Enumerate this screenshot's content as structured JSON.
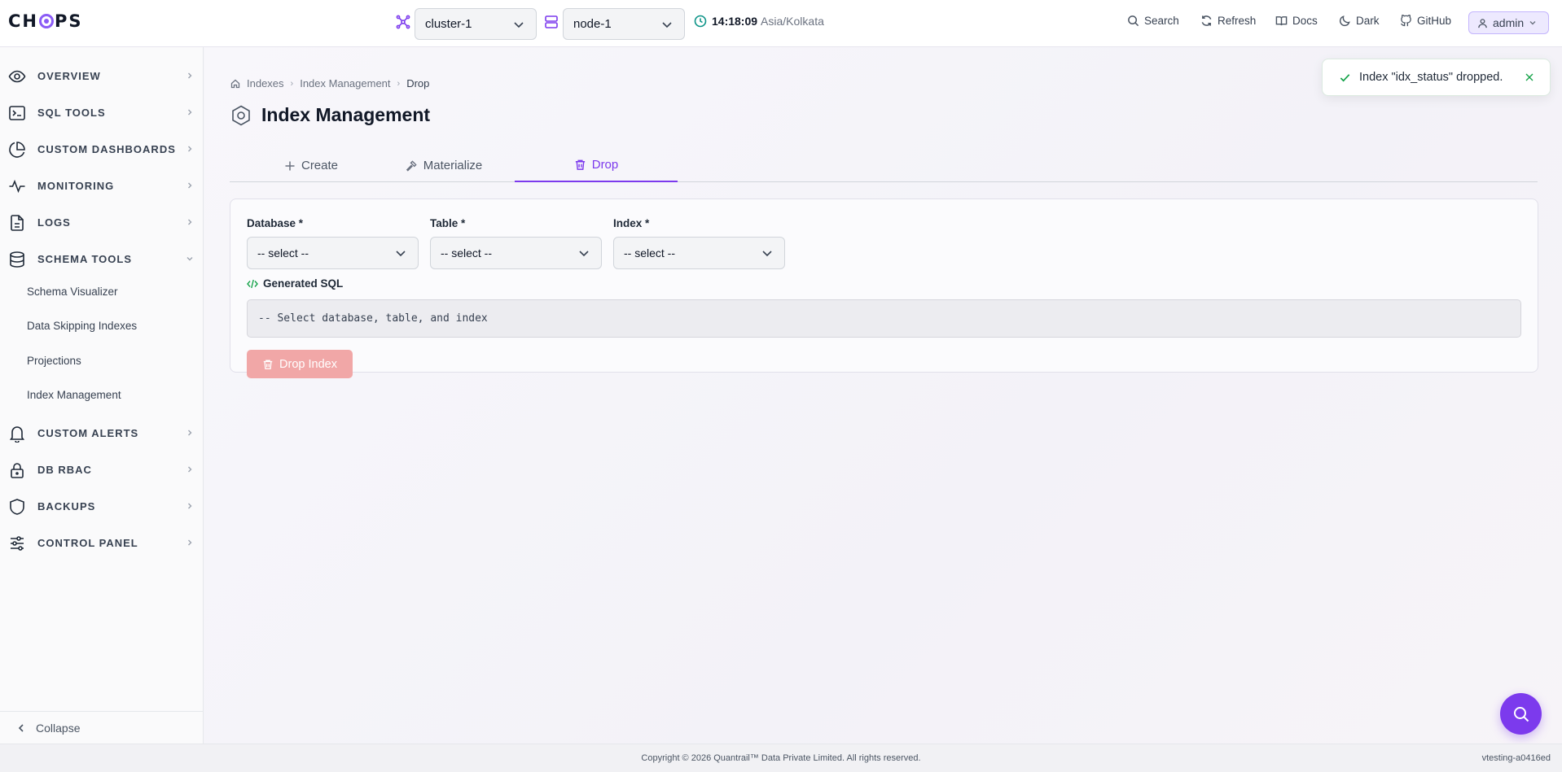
{
  "app": {
    "logo_text": "CHOPS",
    "accent_color": "#7c3aed"
  },
  "header": {
    "cluster_select": "cluster-1",
    "node_select": "node-1",
    "time": "14:18:09",
    "timezone": "Asia/Kolkata",
    "actions": [
      {
        "label": "Search",
        "icon": "search-icon"
      },
      {
        "label": "Refresh",
        "icon": "refresh-icon"
      },
      {
        "label": "Docs",
        "icon": "book-icon"
      },
      {
        "label": "Dark",
        "icon": "moon-icon"
      },
      {
        "label": "GitHub",
        "icon": "github-icon"
      }
    ],
    "user_label": "admin"
  },
  "sidebar": {
    "items": [
      {
        "label": "OVERVIEW",
        "icon": "eye-icon"
      },
      {
        "label": "SQL TOOLS",
        "icon": "terminal-icon"
      },
      {
        "label": "CUSTOM DASHBOARDS",
        "icon": "pie-chart-icon"
      },
      {
        "label": "MONITORING",
        "icon": "activity-icon"
      },
      {
        "label": "LOGS",
        "icon": "file-text-icon"
      },
      {
        "label": "SCHEMA TOOLS",
        "icon": "database-icon",
        "expanded": true
      },
      {
        "label": "CUSTOM ALERTS",
        "icon": "bell-icon"
      },
      {
        "label": "DB RBAC",
        "icon": "lock-icon"
      },
      {
        "label": "BACKUPS",
        "icon": "shield-icon"
      },
      {
        "label": "CONTROL PANEL",
        "icon": "sliders-icon"
      }
    ],
    "schema_subitems": [
      "Schema Visualizer",
      "Data Skipping Indexes",
      "Projections",
      "Index Management"
    ],
    "collapse_label": "Collapse"
  },
  "main": {
    "breadcrumb": [
      "Indexes",
      "Index Management",
      "Drop"
    ],
    "title": "Index Management",
    "tabs": [
      {
        "label": "Create",
        "icon": "plus-icon"
      },
      {
        "label": "Materialize",
        "icon": "hammer-icon"
      },
      {
        "label": "Drop",
        "icon": "trash-icon",
        "active": true
      }
    ],
    "form": {
      "database_label": "Database *",
      "database_value": "-- select --",
      "table_label": "Table *",
      "table_value": "-- select --",
      "index_label": "Index *",
      "index_value": "-- select --",
      "sql_label": "Generated SQL",
      "sql_value": "-- Select database, table, and index",
      "drop_button": "Drop Index"
    }
  },
  "toast": {
    "message": "Index \"idx_status\" dropped.",
    "status_color": "#16a34a"
  },
  "footer": {
    "copyright": "Copyright © 2026 Quantrail™ Data Private Limited. All rights reserved.",
    "version": "vtesting-a0416ed"
  }
}
